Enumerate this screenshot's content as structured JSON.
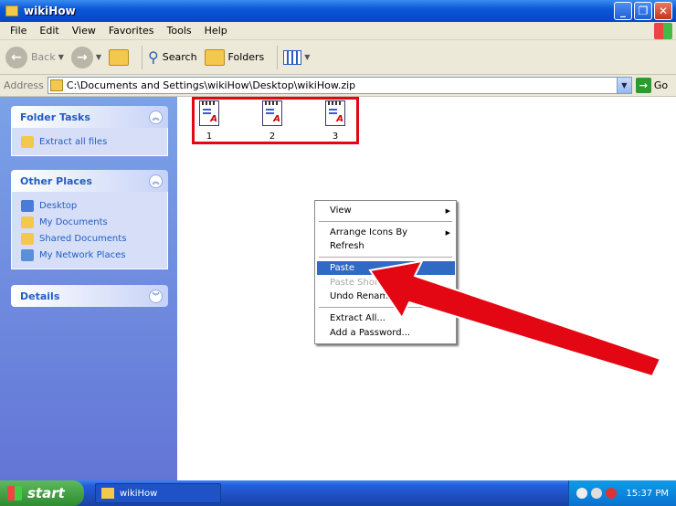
{
  "window": {
    "title": "wikiHow"
  },
  "menubar": [
    "File",
    "Edit",
    "View",
    "Favorites",
    "Tools",
    "Help"
  ],
  "toolbar": {
    "back": "Back",
    "search": "Search",
    "folders": "Folders"
  },
  "address": {
    "label": "Address",
    "value": "C:\\Documents and Settings\\wikiHow\\Desktop\\wikiHow.zip",
    "go": "Go"
  },
  "sidebar": {
    "folder_tasks": {
      "title": "Folder Tasks",
      "items": [
        "Extract all files"
      ]
    },
    "other_places": {
      "title": "Other Places",
      "items": [
        "Desktop",
        "My Documents",
        "Shared Documents",
        "My Network Places"
      ]
    },
    "details": {
      "title": "Details"
    }
  },
  "files": [
    "1",
    "2",
    "3"
  ],
  "context_menu": {
    "items": [
      {
        "label": "View",
        "submenu": true
      },
      {
        "label": "Arrange Icons By",
        "submenu": true
      },
      {
        "label": "Refresh"
      },
      {
        "label": "Paste",
        "highlighted": true
      },
      {
        "label": "Paste Shortcut",
        "disabled": true
      },
      {
        "label": "Undo Rename"
      },
      {
        "label": "Extract All..."
      },
      {
        "label": "Add a Password..."
      }
    ]
  },
  "taskbar": {
    "start": "start",
    "task": "wikiHow",
    "clock": "15:37 PM"
  },
  "colors": {
    "highlight": "#316ac5",
    "annotation": "#e30613",
    "title_blue": "#0a58d8",
    "start_green": "#3a9a3a"
  }
}
